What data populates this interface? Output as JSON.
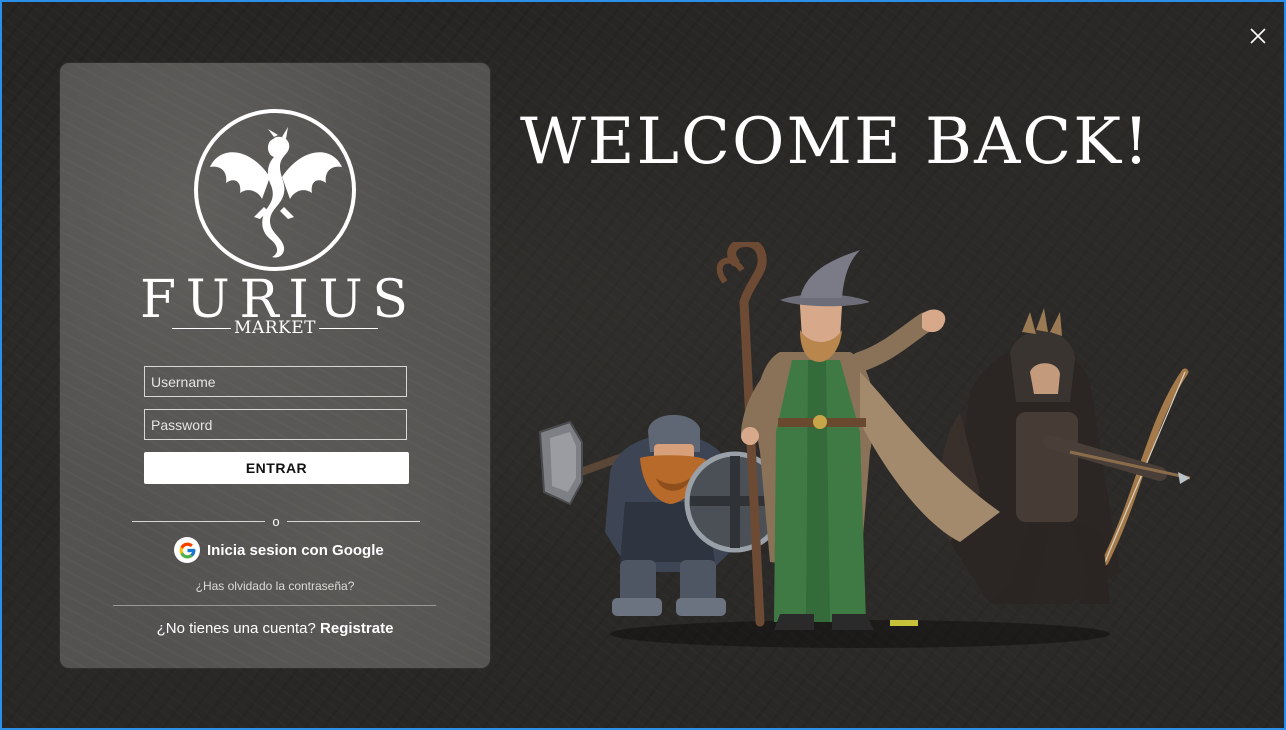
{
  "window": {
    "accent_color": "#2b8ee8",
    "close_icon": "close-icon"
  },
  "login_panel": {
    "logo": {
      "emblem": "dragon-emblem-icon",
      "brand_letters": [
        "F",
        "U",
        "R",
        "I",
        "U",
        "S"
      ],
      "brand_sub": "MARKET"
    },
    "username": {
      "placeholder": "Username",
      "value": ""
    },
    "password": {
      "placeholder": "Password",
      "value": ""
    },
    "enter_button_label": "ENTRAR",
    "divider_text": "o",
    "google": {
      "icon": "google-icon",
      "label": "Inicia sesion con Google"
    },
    "forgot_password_label": "¿Has olvidado la contraseña?",
    "signup": {
      "prompt": "¿No tienes una cuenta?",
      "link_label": "Registrate"
    }
  },
  "hero": {
    "heading": "WELCOME BACK!",
    "artwork": "fantasy-characters-illustration"
  }
}
